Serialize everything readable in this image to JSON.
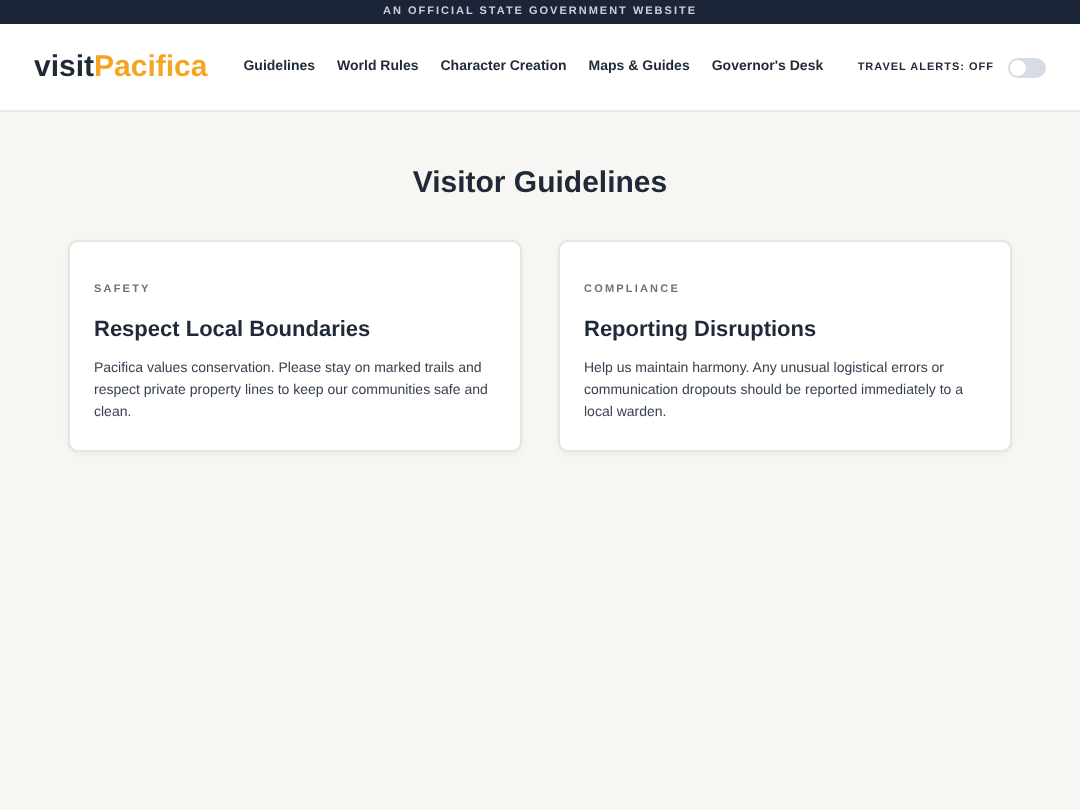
{
  "banner": "AN OFFICIAL STATE GOVERNMENT WEBSITE",
  "logo": {
    "prefix": "visit",
    "accent": "Pacifica"
  },
  "nav": [
    {
      "label": "Guidelines"
    },
    {
      "label": "World Rules"
    },
    {
      "label": "Character Creation"
    },
    {
      "label": "Maps & Guides"
    },
    {
      "label": "Governor's Desk"
    }
  ],
  "travel_alerts": {
    "label": "TRAVEL ALERTS: OFF",
    "on": false
  },
  "heading": "Visitor Guidelines",
  "cards": [
    {
      "category": "SAFETY",
      "title": "Respect Local Boundaries",
      "body": "Pacifica values conservation. Please stay on marked trails and respect private property lines to keep our communities safe and clean."
    },
    {
      "category": "COMPLIANCE",
      "title": "Reporting Disruptions",
      "body": "Help us maintain harmony. Any unusual logistical errors or communication dropouts should be reported immediately to a local warden."
    }
  ]
}
